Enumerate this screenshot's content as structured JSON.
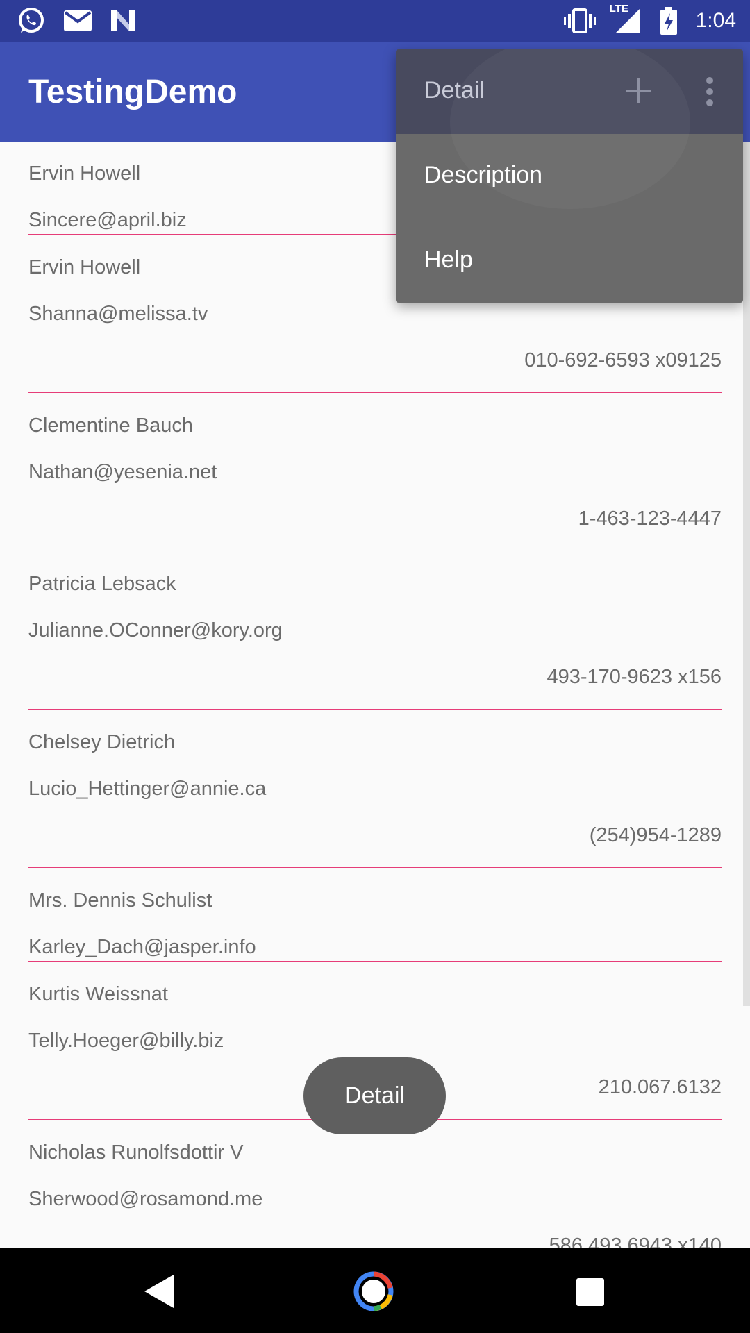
{
  "status_bar": {
    "time": "1:04",
    "left_icons": [
      "whatsapp-icon",
      "gmail-icon",
      "n-icon"
    ],
    "right_icons": [
      "vibrate-icon",
      "lte-signal-icon",
      "battery-charging-icon"
    ],
    "network_label": "LTE"
  },
  "app_bar": {
    "title": "TestingDemo",
    "color": "#3f51b5"
  },
  "overflow_menu": {
    "items": [
      {
        "label": "Detail"
      },
      {
        "label": "Description"
      },
      {
        "label": "Help"
      }
    ]
  },
  "contacts": [
    {
      "name": "Ervin Howell",
      "email": "Sincere@april.biz",
      "phone": ""
    },
    {
      "name": "Ervin Howell",
      "email": "Shanna@melissa.tv",
      "phone": "010-692-6593 x09125"
    },
    {
      "name": "Clementine Bauch",
      "email": "Nathan@yesenia.net",
      "phone": "1-463-123-4447"
    },
    {
      "name": "Patricia Lebsack",
      "email": "Julianne.OConner@kory.org",
      "phone": "493-170-9623 x156"
    },
    {
      "name": "Chelsey Dietrich",
      "email": "Lucio_Hettinger@annie.ca",
      "phone": "(254)954-1289"
    },
    {
      "name": "Mrs. Dennis Schulist",
      "email": "Karley_Dach@jasper.info",
      "phone": ""
    },
    {
      "name": "Kurtis Weissnat",
      "email": "Telly.Hoeger@billy.biz",
      "phone": "210.067.6132"
    },
    {
      "name": "Nicholas Runolfsdottir V",
      "email": "Sherwood@rosamond.me",
      "phone": "586.493.6943 x140"
    }
  ],
  "toast": {
    "text": "Detail"
  },
  "nav_bar": {
    "icons": [
      "back-icon",
      "home-icon",
      "recents-icon"
    ]
  },
  "colors": {
    "divider": "#e63c78",
    "status_bar": "#2e3c98"
  }
}
